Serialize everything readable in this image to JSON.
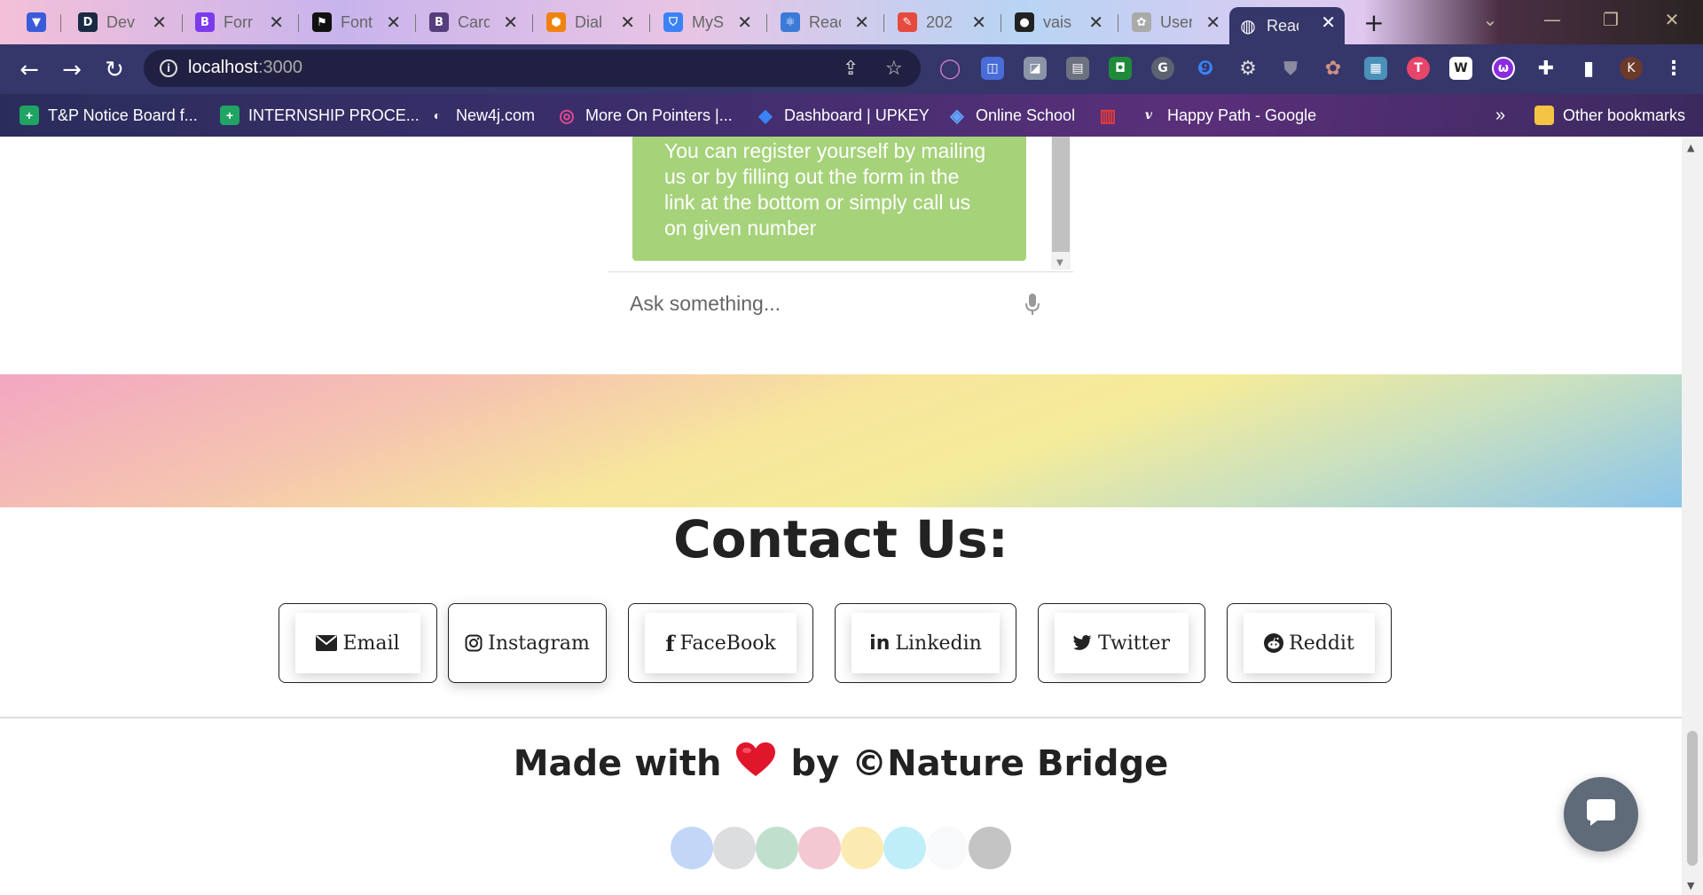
{
  "browser": {
    "tabs": [
      {
        "label": "Dev",
        "favicon_color": "#1a2a44",
        "favicon_glyph": "D"
      },
      {
        "label": "Forr",
        "favicon_color": "#7c3aed",
        "favicon_glyph": "B"
      },
      {
        "label": "Font",
        "favicon_color": "#111111",
        "favicon_glyph": "⚑"
      },
      {
        "label": "Card",
        "favicon_color": "#563d7c",
        "favicon_glyph": "B"
      },
      {
        "label": "Dial",
        "favicon_color": "#f0820f",
        "favicon_glyph": "⬢"
      },
      {
        "label": "MyS",
        "favicon_color": "#3b82f6",
        "favicon_glyph": "⛉"
      },
      {
        "label": "Reac",
        "favicon_color": "#3b7ad6",
        "favicon_glyph": "⚛"
      },
      {
        "label": "202",
        "favicon_color": "#e64a3c",
        "favicon_glyph": "✎"
      },
      {
        "label": "vais",
        "favicon_color": "#222222",
        "favicon_glyph": "●"
      },
      {
        "label": "User",
        "favicon_color": "#aaaaaa",
        "favicon_glyph": "✿"
      },
      {
        "label": "Reac",
        "favicon_color": "#ffffff",
        "favicon_glyph": "◍"
      }
    ],
    "url_host": "localhost",
    "url_port": ":3000",
    "bookmarks": [
      {
        "label": "T&P Notice Board f...",
        "icon_color": "#1fa463",
        "glyph": "+"
      },
      {
        "label": "INTERNSHIP PROCE...",
        "icon_color": "#1fa463",
        "glyph": "+"
      },
      {
        "label": "New4j.com",
        "icon_color": "#222222",
        "glyph": "◐"
      },
      {
        "label": "More On Pointers |...",
        "icon_color": "#e24a8f",
        "glyph": "◎"
      },
      {
        "label": "Dashboard | UPKEY",
        "icon_color": "#3b82f6",
        "glyph": "◆"
      },
      {
        "label": "Online School",
        "icon_color": "#60a5fa",
        "glyph": "◈"
      },
      {
        "label": "",
        "icon_color": "#e23b3b",
        "glyph": "▥"
      },
      {
        "label": "Happy Path - Google",
        "icon_color": "#333333",
        "glyph": "v"
      }
    ],
    "bookmarks_overflow": "»",
    "other_bookmarks": "Other bookmarks",
    "profile_initial": "K"
  },
  "chat": {
    "bot_message": "You can register yourself by mailing us or by filling out the form in the link at the bottom or simply call us on given number",
    "input_placeholder": "Ask something..."
  },
  "contact": {
    "title": "Contact Us:",
    "buttons": [
      {
        "label": "Email",
        "icon": "envelope-icon"
      },
      {
        "label": "Instagram",
        "icon": "instagram-icon"
      },
      {
        "label": "FaceBook",
        "icon": "facebook-icon"
      },
      {
        "label": "Linkedin",
        "icon": "linkedin-icon"
      },
      {
        "label": "Twitter",
        "icon": "twitter-icon"
      },
      {
        "label": "Reddit",
        "icon": "reddit-icon"
      }
    ]
  },
  "footer": {
    "made_with": "Made with",
    "by_text": "by ©Nature Bridge",
    "theme_dots": [
      "#c2d7f7",
      "#dcdddf",
      "#c1dfcd",
      "#f3c8d0",
      "#fbeab1",
      "#bfeef8",
      "#f8f9fa",
      "#c4c4c4"
    ]
  },
  "colors": {
    "chat_bubble": "#a6d27a",
    "chat_fab": "#5f6b79",
    "chrome_toolbar": "#35366a"
  }
}
